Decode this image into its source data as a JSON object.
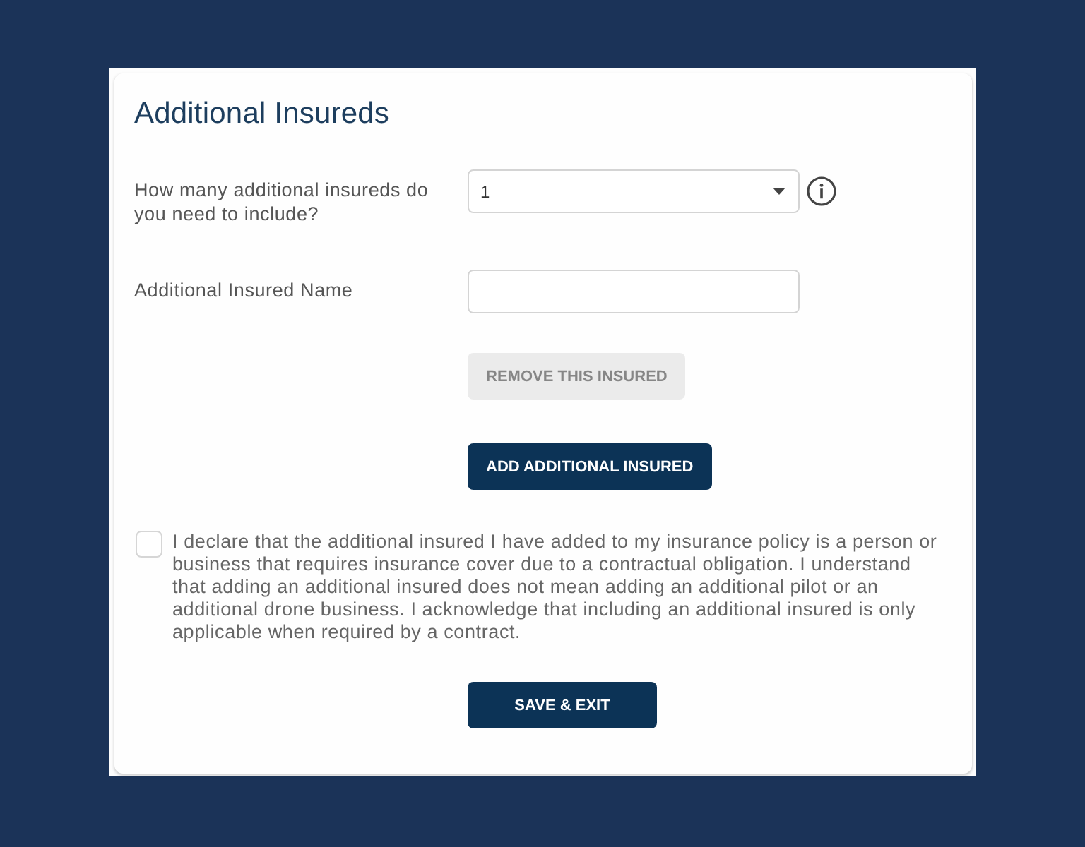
{
  "title": "Additional Insureds",
  "fields": [
    {
      "kind": "select",
      "label": "How many additional insureds do you need to include?",
      "value": "1",
      "info": true
    },
    {
      "kind": "text",
      "label": "Additional Insured Name"
    }
  ],
  "actions": [
    {
      "label": "REMOVE THIS INSURED",
      "disabled": true
    },
    {
      "label": "ADD ADDITIONAL INSURED",
      "disabled": false
    }
  ],
  "declaration": {
    "checked": false,
    "text": "I declare that the additional insured I have added to my insurance policy is a person or business that requires insurance cover due to a contractual obligation. I understand that adding an additional insured does not mean adding an additional pilot or an additional drone business. I acknowledge that including an additional insured is only applicable when required by a contract."
  },
  "save_button": {
    "label": "SAVE & EXIT"
  }
}
